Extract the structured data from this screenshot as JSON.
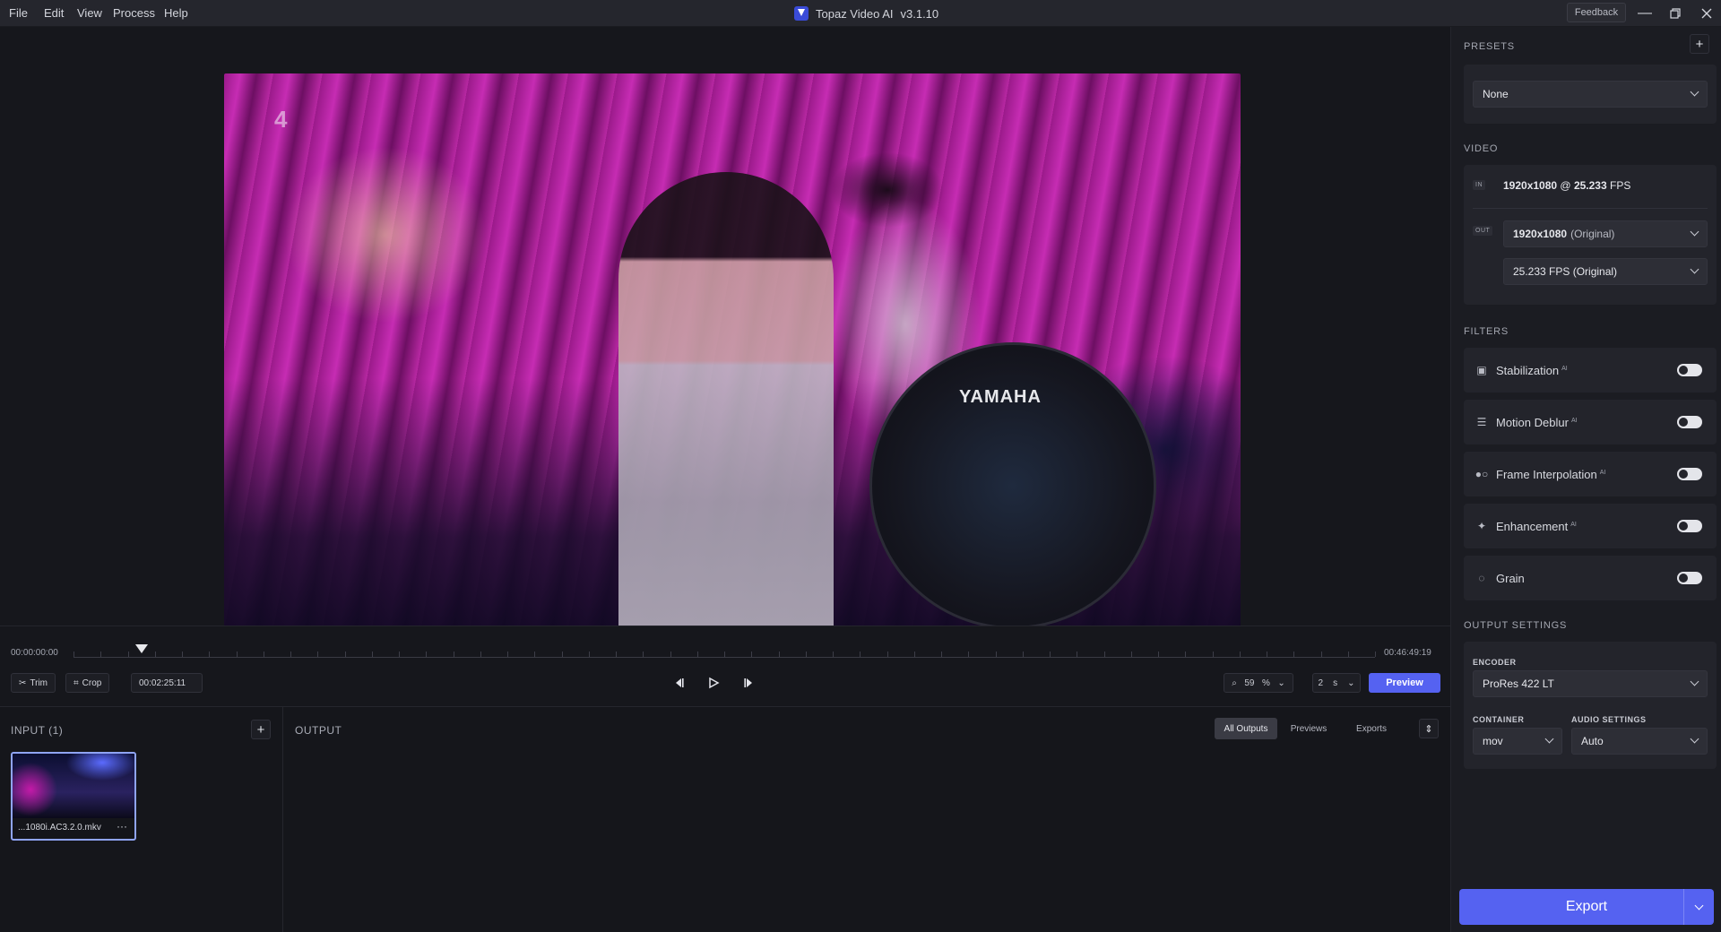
{
  "menu": [
    "File",
    "Edit",
    "View",
    "Process",
    "Help"
  ],
  "app": {
    "title": "Topaz Video AI",
    "version": "v3.1.10"
  },
  "titlebar": {
    "feedback_label": "Feedback"
  },
  "video": {
    "overlay_text": "YAMAHA",
    "channel_logo": "4"
  },
  "timeline": {
    "start_tc": "00:00:00:00",
    "end_tc": "00:46:49:19",
    "current_tc": "00:02:25:11",
    "playhead_fraction": 0.052,
    "trim_label": "Trim",
    "crop_label": "Crop",
    "zoom_value": "59",
    "zoom_unit": "%",
    "step_value": "2",
    "step_unit": "s",
    "preview_label": "Preview"
  },
  "input_panel": {
    "title": "INPUT (1)",
    "file_label": "...1080i.AC3.2.0.mkv",
    "more": "···"
  },
  "output_panel": {
    "title": "OUTPUT",
    "tabs": [
      "All Outputs",
      "Previews",
      "Exports"
    ],
    "active_tab": 0
  },
  "sidebar": {
    "presets_title": "PRESETS",
    "preset_value": "None",
    "video_title": "VIDEO",
    "in_tag": "IN",
    "out_tag": "OUT",
    "in_resolution": "1920x1080",
    "in_fps": "25.233",
    "in_fps_unit": "FPS",
    "in_at": "@",
    "out_resolution": "1920x1080",
    "out_resolution_suffix": "(Original)",
    "out_fps": "25.233 FPS (Original)",
    "filters_title": "FILTERS",
    "ai_tag": "AI",
    "filters": [
      {
        "label": "Stabilization",
        "ai": true,
        "enabled": false
      },
      {
        "label": "Motion Deblur",
        "ai": true,
        "enabled": false
      },
      {
        "label": "Frame Interpolation",
        "ai": true,
        "enabled": false
      },
      {
        "label": "Enhancement",
        "ai": true,
        "enabled": false
      },
      {
        "label": "Grain",
        "ai": false,
        "enabled": false
      }
    ],
    "output_title": "OUTPUT SETTINGS",
    "encoder_label": "ENCODER",
    "encoder_value": "ProRes 422 LT",
    "container_label": "CONTAINER",
    "container_value": "mov",
    "audio_label": "AUDIO SETTINGS",
    "audio_value": "Auto",
    "export_label": "Export"
  },
  "colors": {
    "accent": "#5562f1",
    "panel": "#23242b",
    "background": "#16171c"
  }
}
